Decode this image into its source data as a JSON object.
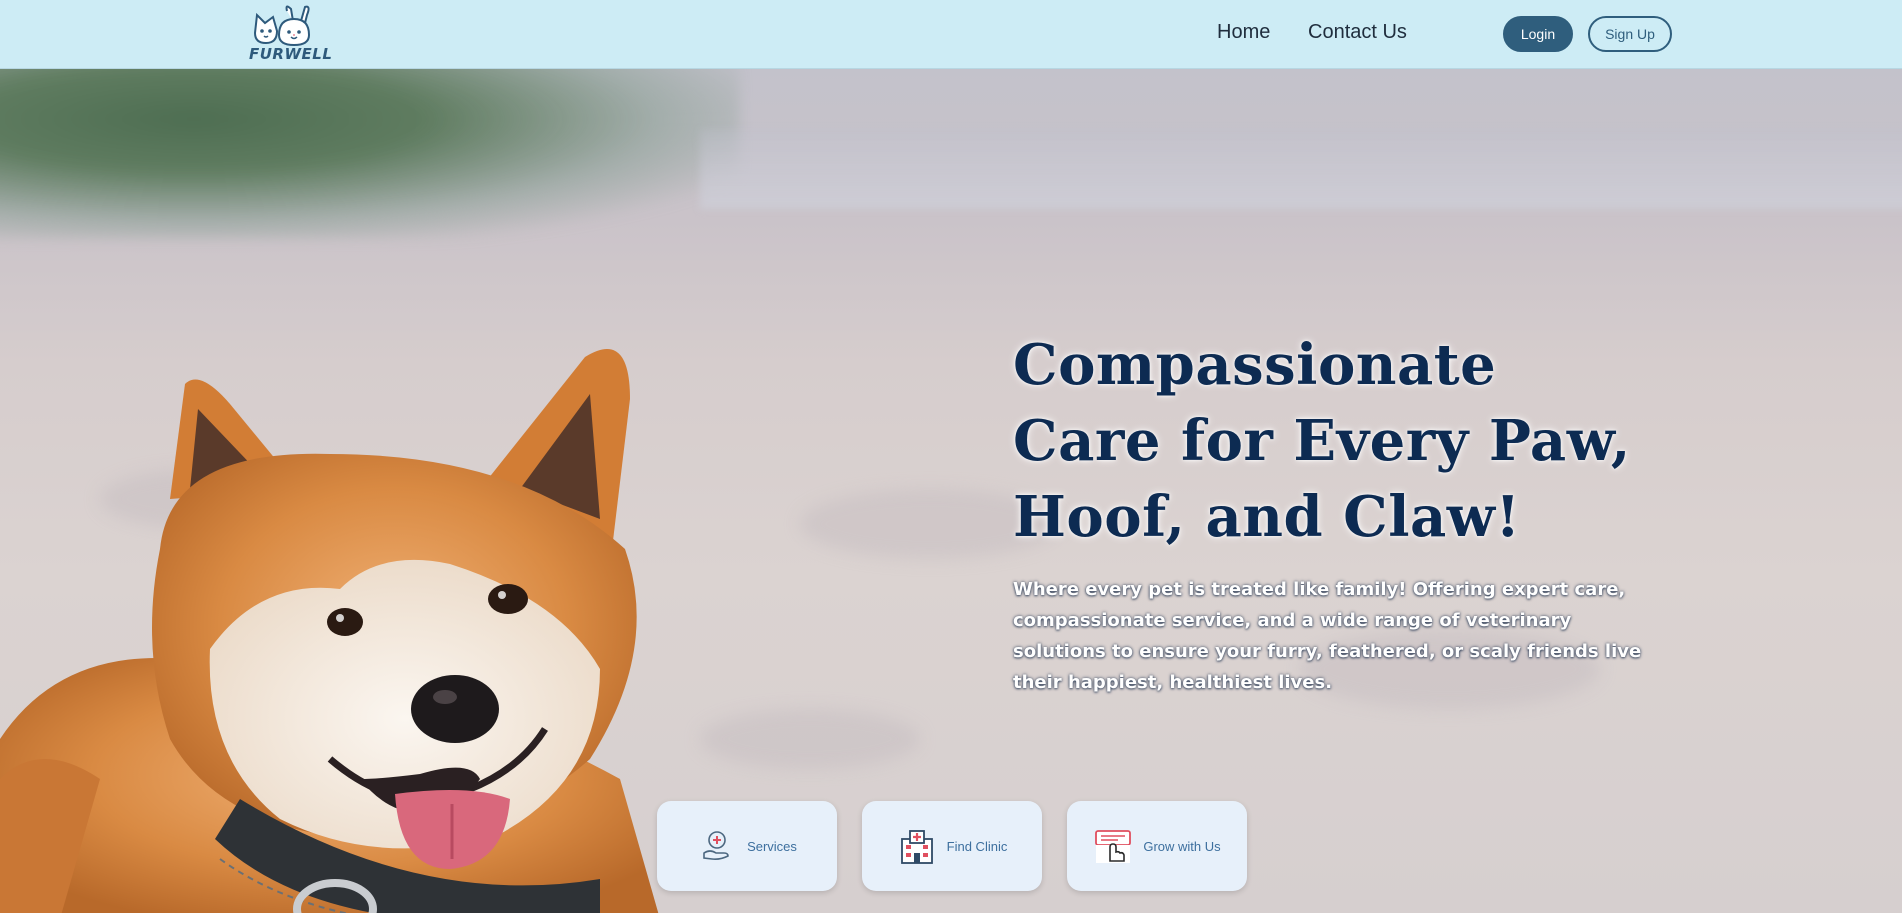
{
  "header": {
    "logo_text": "FURWELL",
    "nav": {
      "home": "Home",
      "contact": "Contact Us"
    },
    "buttons": {
      "login": "Login",
      "signup": "Sign Up"
    }
  },
  "hero": {
    "title": "Compassionate Care for Every Paw, Hoof, and Claw!",
    "subtitle": "Where every pet is treated like family! Offering expert care, compassionate service, and a wide range of veterinary solutions to ensure your furry, feathered, or scaly friends live their happiest, healthiest lives."
  },
  "cards": [
    {
      "label": "Services",
      "icon": "hand-heart-icon"
    },
    {
      "label": "Find Clinic",
      "icon": "hospital-icon"
    },
    {
      "label": "Grow with Us",
      "icon": "click-pointer-icon"
    }
  ],
  "colors": {
    "header_bg": "#cdecf5",
    "primary": "#2f5e7d",
    "title": "#0d2b52",
    "card_bg": "#e7f0fa",
    "card_text": "#3d6f9e"
  }
}
